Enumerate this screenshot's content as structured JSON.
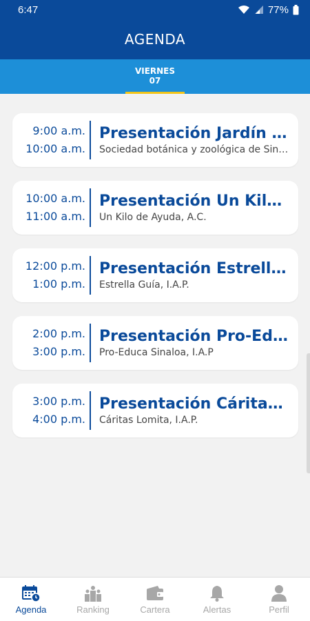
{
  "status_bar": {
    "time": "6:47",
    "battery": "77%"
  },
  "header": {
    "title": "AGENDA"
  },
  "tabs": [
    {
      "day": "VIERNES",
      "date": "07"
    }
  ],
  "events": [
    {
      "start": "9:00 a.m.",
      "end": "10:00 a.m.",
      "title": "Presentación Jardín Botánico y Zoológico",
      "subtitle": "Sociedad botánica y zoológica de Sinaloa"
    },
    {
      "start": "10:00 a.m.",
      "end": "11:00 a.m.",
      "title": "Presentación Un Kilo de Ayuda",
      "subtitle": "Un Kilo de Ayuda, A.C."
    },
    {
      "start": "12:00 p.m.",
      "end": "1:00 p.m.",
      "title": "Presentación Estrella Guía",
      "subtitle": "Estrella Guía, I.A.P."
    },
    {
      "start": "2:00 p.m.",
      "end": "3:00 p.m.",
      "title": "Presentación Pro-Educa Sinaloa",
      "subtitle": "Pro-Educa Sinaloa, I.A.P"
    },
    {
      "start": "3:00 p.m.",
      "end": "4:00 p.m.",
      "title": "Presentación Cáritas Lomita",
      "subtitle": "Cáritas Lomita, I.A.P."
    }
  ],
  "nav": [
    {
      "label": "Agenda",
      "icon": "calendar-icon",
      "active": true
    },
    {
      "label": "Ranking",
      "icon": "ranking-icon",
      "active": false
    },
    {
      "label": "Cartera",
      "icon": "wallet-icon",
      "active": false
    },
    {
      "label": "Alertas",
      "icon": "bell-icon",
      "active": false
    },
    {
      "label": "Perfil",
      "icon": "user-icon",
      "active": false
    }
  ],
  "colors": {
    "primary": "#0a4a9a",
    "tab_bar": "#1d8fd8",
    "tab_indicator": "#f2c418",
    "inactive": "#a7a7a7"
  }
}
